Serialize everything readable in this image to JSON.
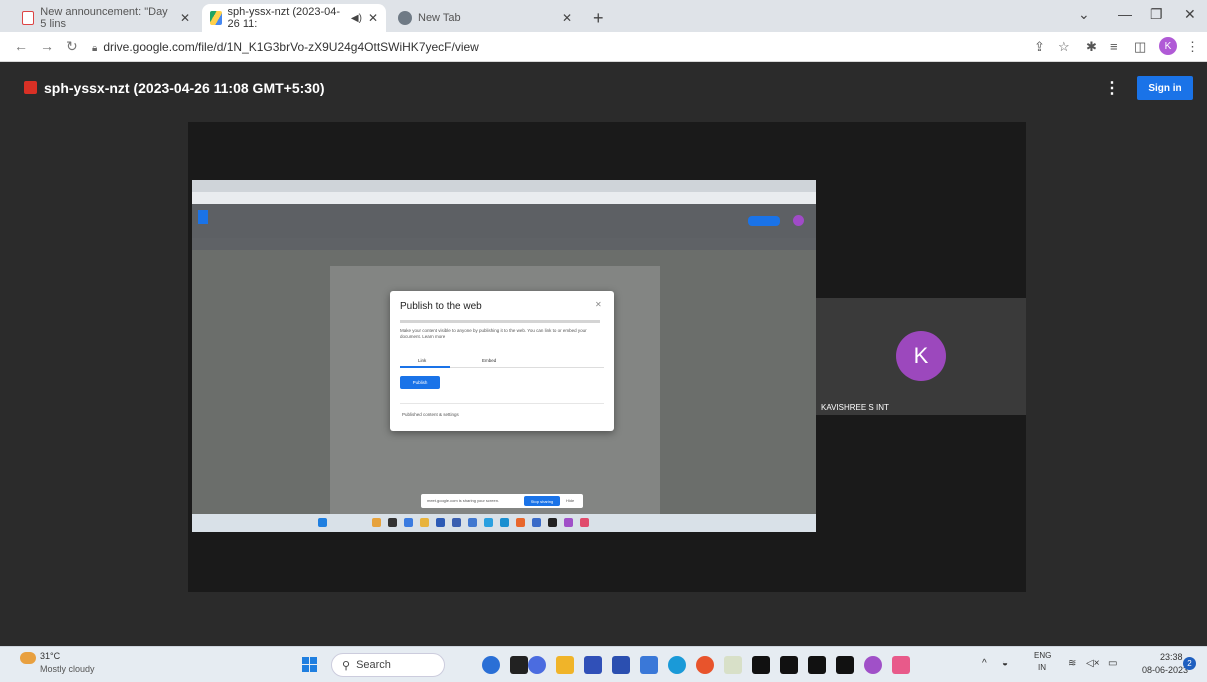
{
  "browser": {
    "tabs": [
      {
        "label": "New announcement: \"Day 5 lins",
        "icon": "gmail-icon"
      },
      {
        "label": "sph-yssx-nzt (2023-04-26 11:",
        "icon": "drive-icon"
      },
      {
        "label": "New Tab",
        "icon": "chrome-icon"
      }
    ],
    "new_tab": "+",
    "url": "drive.google.com/file/d/1N_K1G3brVo-zX9U24g4OttSWiHK7yecF/view",
    "profile_initial": "K"
  },
  "viewer": {
    "title": "sph-yssx-nzt (2023-04-26 11:08 GMT+5:30)",
    "sign_in": "Sign in"
  },
  "shared_screen": {
    "dialog": {
      "title": "Publish to the web",
      "desc": "Make your content visible to anyone by publishing it to the web. You can link to or embed your document. Learn more",
      "tabs": [
        "Link",
        "Embed"
      ],
      "publish": "Publish",
      "footer": "Published content & settings"
    },
    "share_bar": {
      "text": "meet.google.com is sharing your screen.",
      "stop": "Stop sharing",
      "hide": "Hide"
    }
  },
  "participant": {
    "initial": "K",
    "name": "KAVISHREE S INT"
  },
  "taskbar": {
    "weather_temp": "31°C",
    "weather_desc": "Mostly cloudy",
    "search": "Search",
    "lang_top": "ENG",
    "lang_bottom": "IN",
    "time": "23:38",
    "date": "08-06-2023",
    "notifications": "2"
  }
}
